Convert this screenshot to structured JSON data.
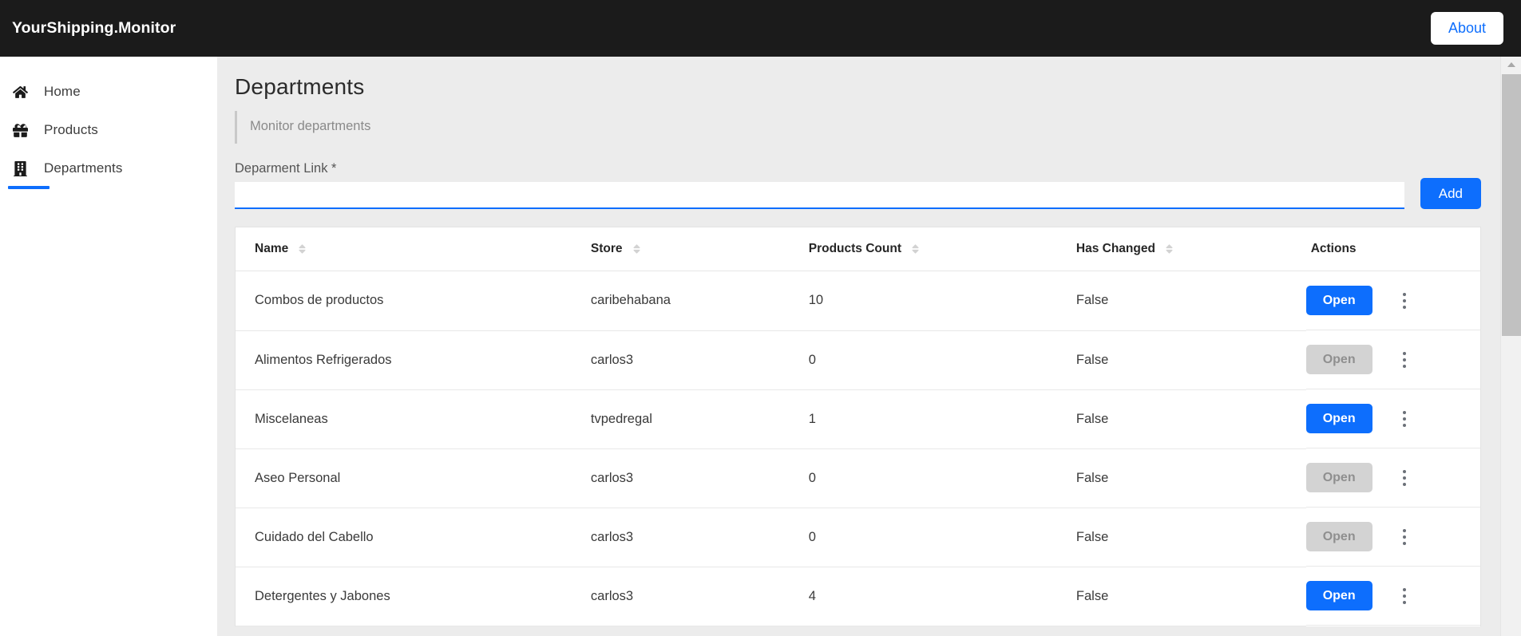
{
  "navbar": {
    "brand": "YourShipping.Monitor",
    "about_label": "About"
  },
  "sidebar": {
    "items": [
      {
        "label": "Home",
        "icon": "home-icon",
        "active": false
      },
      {
        "label": "Products",
        "icon": "gift-icon",
        "active": false
      },
      {
        "label": "Departments",
        "icon": "building-icon",
        "active": true
      }
    ]
  },
  "page": {
    "title": "Departments",
    "subtitle": "Monitor departments"
  },
  "form": {
    "label": "Deparment Link *",
    "value": "",
    "placeholder": "",
    "add_label": "Add"
  },
  "table": {
    "columns": [
      {
        "label": "Name",
        "sortable": true
      },
      {
        "label": "Store",
        "sortable": true
      },
      {
        "label": "Products Count",
        "sortable": true
      },
      {
        "label": "Has Changed",
        "sortable": true
      },
      {
        "label": "Actions",
        "sortable": false
      }
    ],
    "open_label": "Open",
    "rows": [
      {
        "name": "Combos de productos",
        "store": "caribehabana",
        "count": "10",
        "changed": "False",
        "open_enabled": true
      },
      {
        "name": "Alimentos Refrigerados",
        "store": "carlos3",
        "count": "0",
        "changed": "False",
        "open_enabled": false
      },
      {
        "name": "Miscelaneas",
        "store": "tvpedregal",
        "count": "1",
        "changed": "False",
        "open_enabled": true
      },
      {
        "name": "Aseo Personal",
        "store": "carlos3",
        "count": "0",
        "changed": "False",
        "open_enabled": false
      },
      {
        "name": "Cuidado del Cabello",
        "store": "carlos3",
        "count": "0",
        "changed": "False",
        "open_enabled": false
      },
      {
        "name": "Detergentes y Jabones",
        "store": "carlos3",
        "count": "4",
        "changed": "False",
        "open_enabled": true
      }
    ]
  },
  "colors": {
    "navbar_bg": "#1b1b1b",
    "accent": "#0d6efd",
    "content_bg": "#ececec",
    "disabled": "#d3d3d3"
  }
}
